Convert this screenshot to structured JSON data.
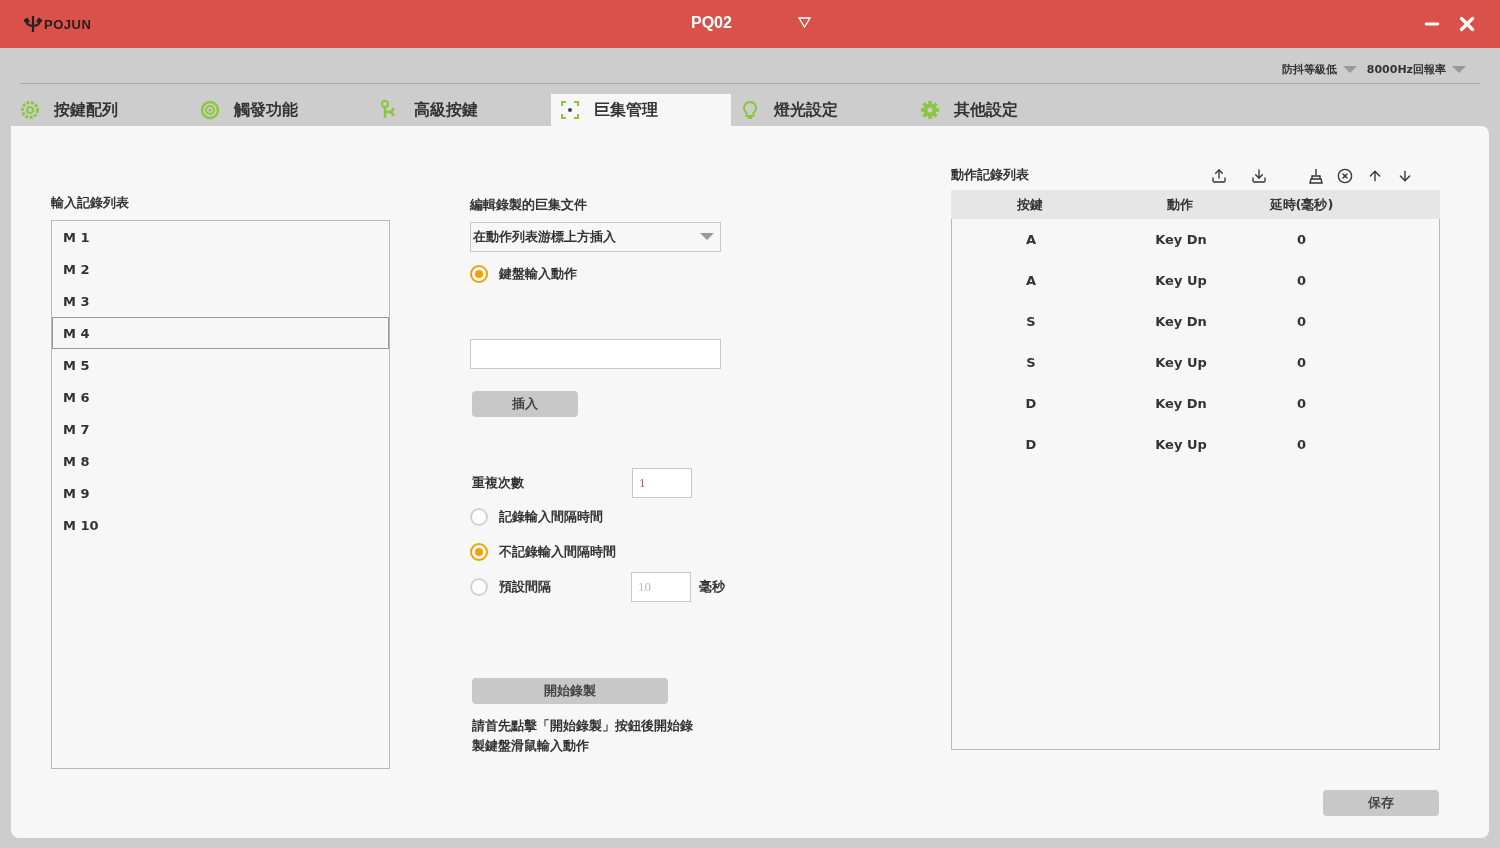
{
  "window": {
    "logo": "POJUN",
    "title": "PQ02"
  },
  "top_settings": [
    {
      "label": "防抖等級低"
    },
    {
      "label": "8000Hz回報率"
    }
  ],
  "tabs": [
    {
      "label": "按鍵配列",
      "selected": false
    },
    {
      "label": "觸發功能",
      "selected": false
    },
    {
      "label": "高級按鍵",
      "selected": false
    },
    {
      "label": "巨集管理",
      "selected": true
    },
    {
      "label": "燈光設定",
      "selected": false
    },
    {
      "label": "其他設定",
      "selected": false
    }
  ],
  "macro_list": {
    "title": "輸入記錄列表",
    "items": [
      {
        "label": "M 1",
        "selected": false
      },
      {
        "label": "M 2",
        "selected": false
      },
      {
        "label": "M 3",
        "selected": false
      },
      {
        "label": "M 4",
        "selected": true
      },
      {
        "label": "M 5",
        "selected": false
      },
      {
        "label": "M 6",
        "selected": false
      },
      {
        "label": "M 7",
        "selected": false
      },
      {
        "label": "M 8",
        "selected": false
      },
      {
        "label": "M 9",
        "selected": false
      },
      {
        "label": "M 10",
        "selected": false
      }
    ]
  },
  "editor": {
    "title": "編輯錄製的巨集文件",
    "insert_mode": "在動作列表游標上方插入",
    "input_types": [
      {
        "label": "鍵盤輸入動作",
        "selected": true
      }
    ],
    "insert_button": "插入",
    "repeat_label": "重複次數",
    "repeat_value": "1",
    "interval_options": [
      {
        "label": "記錄輸入間隔時間",
        "selected": false
      },
      {
        "label": "不記錄輸入間隔時間",
        "selected": true
      },
      {
        "label": "預設間隔",
        "selected": false
      }
    ],
    "interval_placeholder": "10",
    "interval_unit": "毫秒",
    "record_button": "開始錄製",
    "hint": "請首先點擊「開始錄製」按鈕後開始錄製鍵盤滑鼠輸入動作"
  },
  "action_list": {
    "title": "動作記錄列表",
    "columns": [
      "按鍵",
      "動作",
      "延時(毫秒)"
    ],
    "rows": [
      {
        "key": "A",
        "action": "Key Dn",
        "delay": "0"
      },
      {
        "key": "A",
        "action": "Key Up",
        "delay": "0"
      },
      {
        "key": "S",
        "action": "Key Dn",
        "delay": "0"
      },
      {
        "key": "S",
        "action": "Key Up",
        "delay": "0"
      },
      {
        "key": "D",
        "action": "Key Dn",
        "delay": "0"
      },
      {
        "key": "D",
        "action": "Key Up",
        "delay": "0"
      }
    ]
  },
  "save_button": "保存"
}
